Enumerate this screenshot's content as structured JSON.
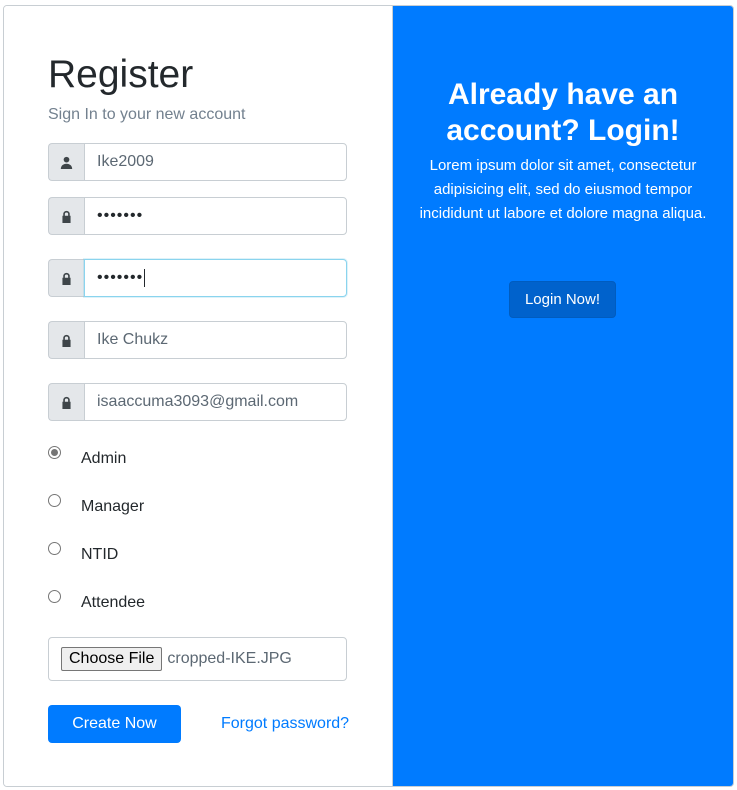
{
  "register": {
    "title": "Register",
    "subtitle": "Sign In to your new account",
    "fields": [
      {
        "icon": "user-icon",
        "value": "Ike2009",
        "type": "text"
      },
      {
        "icon": "lock-icon",
        "value": "•••••••",
        "type": "password"
      },
      {
        "icon": "lock-icon",
        "value": "•••••••",
        "type": "password",
        "focused": true
      },
      {
        "icon": "lock-icon",
        "value": "Ike Chukz",
        "type": "text"
      },
      {
        "icon": "lock-icon",
        "value": "isaaccuma3093@gmail.com",
        "type": "text"
      }
    ],
    "roles": [
      {
        "label": "Admin",
        "checked": true
      },
      {
        "label": "Manager",
        "checked": false
      },
      {
        "label": "NTID",
        "checked": false
      },
      {
        "label": "Attendee",
        "checked": false
      }
    ],
    "file": {
      "button_label": "Choose File",
      "file_name": "cropped-IKE.JPG"
    },
    "create_label": "Create Now",
    "forgot_label": "Forgot password?"
  },
  "login_panel": {
    "title": "Already have an account? Login!",
    "text": "Lorem ipsum dolor sit amet, consectetur adipisicing elit, sed do eiusmod tempor incididunt ut labore et dolore magna aliqua.",
    "button_label": "Login Now!"
  },
  "colors": {
    "primary": "#007bff",
    "primary_dark": "#0062cc",
    "border": "#c8ced3",
    "addon_bg": "#e4e7ea"
  }
}
